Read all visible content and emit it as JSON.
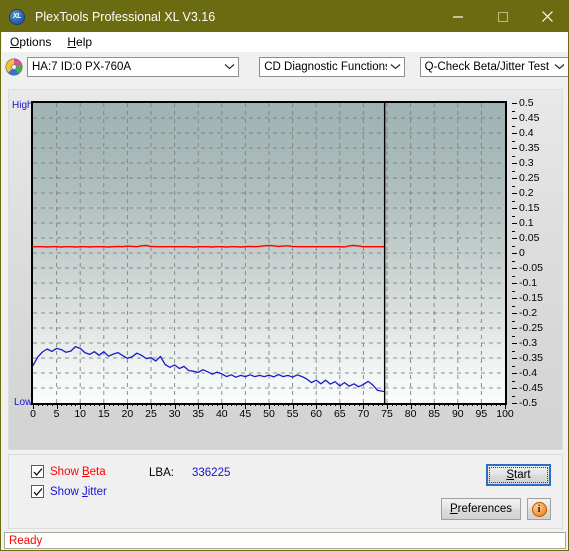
{
  "window": {
    "title": "PlexTools Professional XL V3.16",
    "icon": "xl-app-icon",
    "icon_text": "XL",
    "titlebar_color": "#6b6b11",
    "minimize_label": "—",
    "maximize_label": "□",
    "close_label": "✕"
  },
  "menubar": {
    "items": [
      {
        "label": "Options",
        "accel": "O"
      },
      {
        "label": "Help",
        "accel": "H"
      }
    ]
  },
  "toolbar": {
    "disc_icon": "cd-disc-icon",
    "drive_select": {
      "value": "HA:7 ID:0  PX-760A",
      "options": [
        "HA:7 ID:0  PX-760A"
      ]
    },
    "function_select": {
      "value": "CD Diagnostic Functions",
      "options": [
        "CD Diagnostic Functions"
      ]
    },
    "test_select": {
      "value": "Q-Check Beta/Jitter Test",
      "options": [
        "Q-Check Beta/Jitter Test"
      ]
    }
  },
  "chart_data": {
    "type": "line",
    "title": "Q-Check Beta/Jitter Test",
    "xlabel": "",
    "ylabel": "",
    "xlim": [
      0,
      100
    ],
    "ylim": [
      -0.5,
      0.5
    ],
    "grid": true,
    "legend_position": "bottom-left",
    "y_left_labels": {
      "top": "High",
      "bottom": "Low"
    },
    "yticks": [
      0.5,
      0.45,
      0.4,
      0.35,
      0.3,
      0.25,
      0.2,
      0.15,
      0.1,
      0.05,
      0,
      -0.05,
      -0.1,
      -0.15,
      -0.2,
      -0.25,
      -0.3,
      -0.35,
      -0.4,
      -0.45,
      -0.5
    ],
    "ytick_labels": [
      "0.5",
      "0.45",
      "0.4",
      "0.35",
      "0.3",
      "0.25",
      "0.2",
      "0.15",
      "0.1",
      "0.05",
      "0",
      "-0.05",
      "-0.1",
      "-0.15",
      "-0.2",
      "-0.25",
      "-0.3",
      "-0.35",
      "-0.4",
      "-0.45",
      "-0.5"
    ],
    "xticks": [
      0,
      5,
      10,
      15,
      20,
      25,
      30,
      35,
      40,
      45,
      50,
      55,
      60,
      65,
      70,
      75,
      80,
      85,
      90,
      95,
      100
    ],
    "xtick_labels": [
      "0",
      "5",
      "10",
      "15",
      "20",
      "25",
      "30",
      "35",
      "40",
      "45",
      "50",
      "55",
      "60",
      "65",
      "70",
      "75",
      "80",
      "85",
      "90",
      "95",
      "100"
    ],
    "data_end_marker_x": 74.5,
    "series": [
      {
        "name": "Beta",
        "color": "#ff0000",
        "x": [
          0,
          1,
          2,
          3,
          4,
          5,
          6,
          7,
          8,
          9,
          10,
          11,
          12,
          13,
          14,
          15,
          16,
          17,
          18,
          19,
          20,
          21,
          22,
          23,
          24,
          25,
          26,
          27,
          28,
          29,
          30,
          31,
          32,
          33,
          34,
          35,
          36,
          37,
          38,
          39,
          40,
          41,
          42,
          43,
          44,
          45,
          46,
          47,
          48,
          49,
          50,
          51,
          52,
          53,
          54,
          55,
          56,
          57,
          58,
          59,
          60,
          61,
          62,
          63,
          64,
          65,
          66,
          67,
          68,
          69,
          70,
          71,
          72,
          73,
          74.5
        ],
        "values": [
          0.021,
          0.021,
          0.021,
          0.02,
          0.021,
          0.021,
          0.02,
          0.021,
          0.021,
          0.02,
          0.021,
          0.021,
          0.02,
          0.021,
          0.021,
          0.021,
          0.02,
          0.021,
          0.022,
          0.021,
          0.023,
          0.022,
          0.021,
          0.024,
          0.025,
          0.022,
          0.021,
          0.021,
          0.021,
          0.021,
          0.021,
          0.021,
          0.021,
          0.021,
          0.02,
          0.021,
          0.021,
          0.021,
          0.02,
          0.021,
          0.021,
          0.02,
          0.021,
          0.021,
          0.02,
          0.021,
          0.022,
          0.021,
          0.022,
          0.024,
          0.025,
          0.024,
          0.022,
          0.023,
          0.024,
          0.022,
          0.021,
          0.021,
          0.021,
          0.021,
          0.021,
          0.021,
          0.021,
          0.021,
          0.021,
          0.021,
          0.02,
          0.024,
          0.025,
          0.023,
          0.021,
          0.021,
          0.021,
          0.021,
          0.021
        ]
      },
      {
        "name": "Jitter",
        "color": "#1b1bc8",
        "x": [
          0,
          1,
          2,
          3,
          4,
          5,
          6,
          7,
          8,
          9,
          10,
          11,
          12,
          13,
          14,
          15,
          16,
          17,
          18,
          19,
          20,
          21,
          22,
          23,
          24,
          25,
          26,
          27,
          28,
          29,
          30,
          31,
          32,
          33,
          34,
          35,
          36,
          37,
          38,
          39,
          40,
          41,
          42,
          43,
          44,
          45,
          46,
          47,
          48,
          49,
          50,
          51,
          52,
          53,
          54,
          55,
          56,
          57,
          58,
          59,
          60,
          61,
          62,
          63,
          64,
          65,
          66,
          67,
          68,
          69,
          70,
          71,
          72,
          73,
          74.5
        ],
        "values": [
          -0.375,
          -0.347,
          -0.33,
          -0.32,
          -0.328,
          -0.318,
          -0.322,
          -0.331,
          -0.327,
          -0.312,
          -0.318,
          -0.332,
          -0.338,
          -0.329,
          -0.341,
          -0.329,
          -0.344,
          -0.337,
          -0.332,
          -0.342,
          -0.351,
          -0.346,
          -0.334,
          -0.341,
          -0.352,
          -0.349,
          -0.36,
          -0.345,
          -0.372,
          -0.381,
          -0.373,
          -0.385,
          -0.378,
          -0.392,
          -0.394,
          -0.398,
          -0.389,
          -0.396,
          -0.404,
          -0.397,
          -0.403,
          -0.412,
          -0.406,
          -0.414,
          -0.408,
          -0.412,
          -0.406,
          -0.412,
          -0.408,
          -0.412,
          -0.407,
          -0.413,
          -0.405,
          -0.412,
          -0.408,
          -0.414,
          -0.406,
          -0.412,
          -0.42,
          -0.432,
          -0.424,
          -0.436,
          -0.424,
          -0.437,
          -0.429,
          -0.443,
          -0.432,
          -0.444,
          -0.436,
          -0.446,
          -0.438,
          -0.428,
          -0.44,
          -0.458,
          -0.462
        ]
      }
    ]
  },
  "controls": {
    "show_beta": {
      "label_pre": "Show ",
      "label_accel": "B",
      "label_post": "eta",
      "checked": true,
      "color": "#ff0000"
    },
    "show_jitter": {
      "label_pre": "Show ",
      "label_accel": "J",
      "label_post": "itter",
      "checked": true,
      "color": "#1414d2"
    },
    "lba_label": "LBA:",
    "lba_value": "336225",
    "start_button": {
      "label_pre": "",
      "label_accel": "S",
      "label_post": "tart",
      "focused": true
    },
    "preferences_button": {
      "label_pre": "",
      "label_accel": "P",
      "label_post": "references"
    },
    "info_button": {
      "icon": "info-icon",
      "glyph": "i"
    }
  },
  "statusbar": {
    "text": "Ready",
    "color": "#ff0000"
  }
}
